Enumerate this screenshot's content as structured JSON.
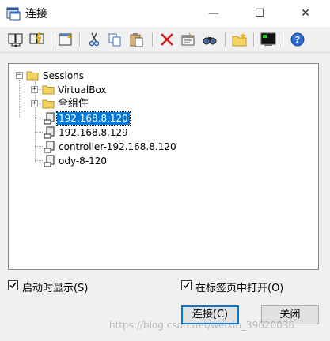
{
  "window": {
    "title": "连接",
    "minimize_glyph": "—",
    "maximize_glyph": "☐",
    "close_glyph": "✕"
  },
  "toolbar": {
    "buttons": [
      {
        "icon": "connect-icon"
      },
      {
        "icon": "quick-connect-icon"
      },
      {
        "icon": "new-session-icon"
      },
      {
        "icon": "cut-icon"
      },
      {
        "icon": "copy-icon"
      },
      {
        "icon": "paste-icon"
      },
      {
        "icon": "delete-icon"
      },
      {
        "icon": "properties-icon"
      },
      {
        "icon": "find-icon"
      },
      {
        "icon": "new-folder-icon"
      },
      {
        "icon": "terminal-icon"
      },
      {
        "icon": "help-icon"
      }
    ]
  },
  "tree": {
    "root": {
      "label": "Sessions",
      "expander": "−"
    },
    "folders": [
      {
        "label": "VirtualBox",
        "expander": "+"
      },
      {
        "label": "全组件",
        "expander": "+"
      }
    ],
    "sessions": [
      {
        "label": "192.168.8.120",
        "selected": true
      },
      {
        "label": "192.168.8.129",
        "selected": false
      },
      {
        "label": "controller-192.168.8.120",
        "selected": false
      },
      {
        "label": "ody-8-120",
        "selected": false
      }
    ]
  },
  "options": {
    "show_on_startup": {
      "label": "启动时显示(S)",
      "checked": true
    },
    "open_in_tab": {
      "label": "在标签页中打开(O)",
      "checked": true
    }
  },
  "buttons": {
    "connect": "连接(C)",
    "close": "关闭"
  },
  "watermark": "https://blog.csdn.net/weixin_39620036",
  "colors": {
    "selection": "#0078d7",
    "folder": "#f4d35e",
    "focus_border": "#0078d7"
  }
}
